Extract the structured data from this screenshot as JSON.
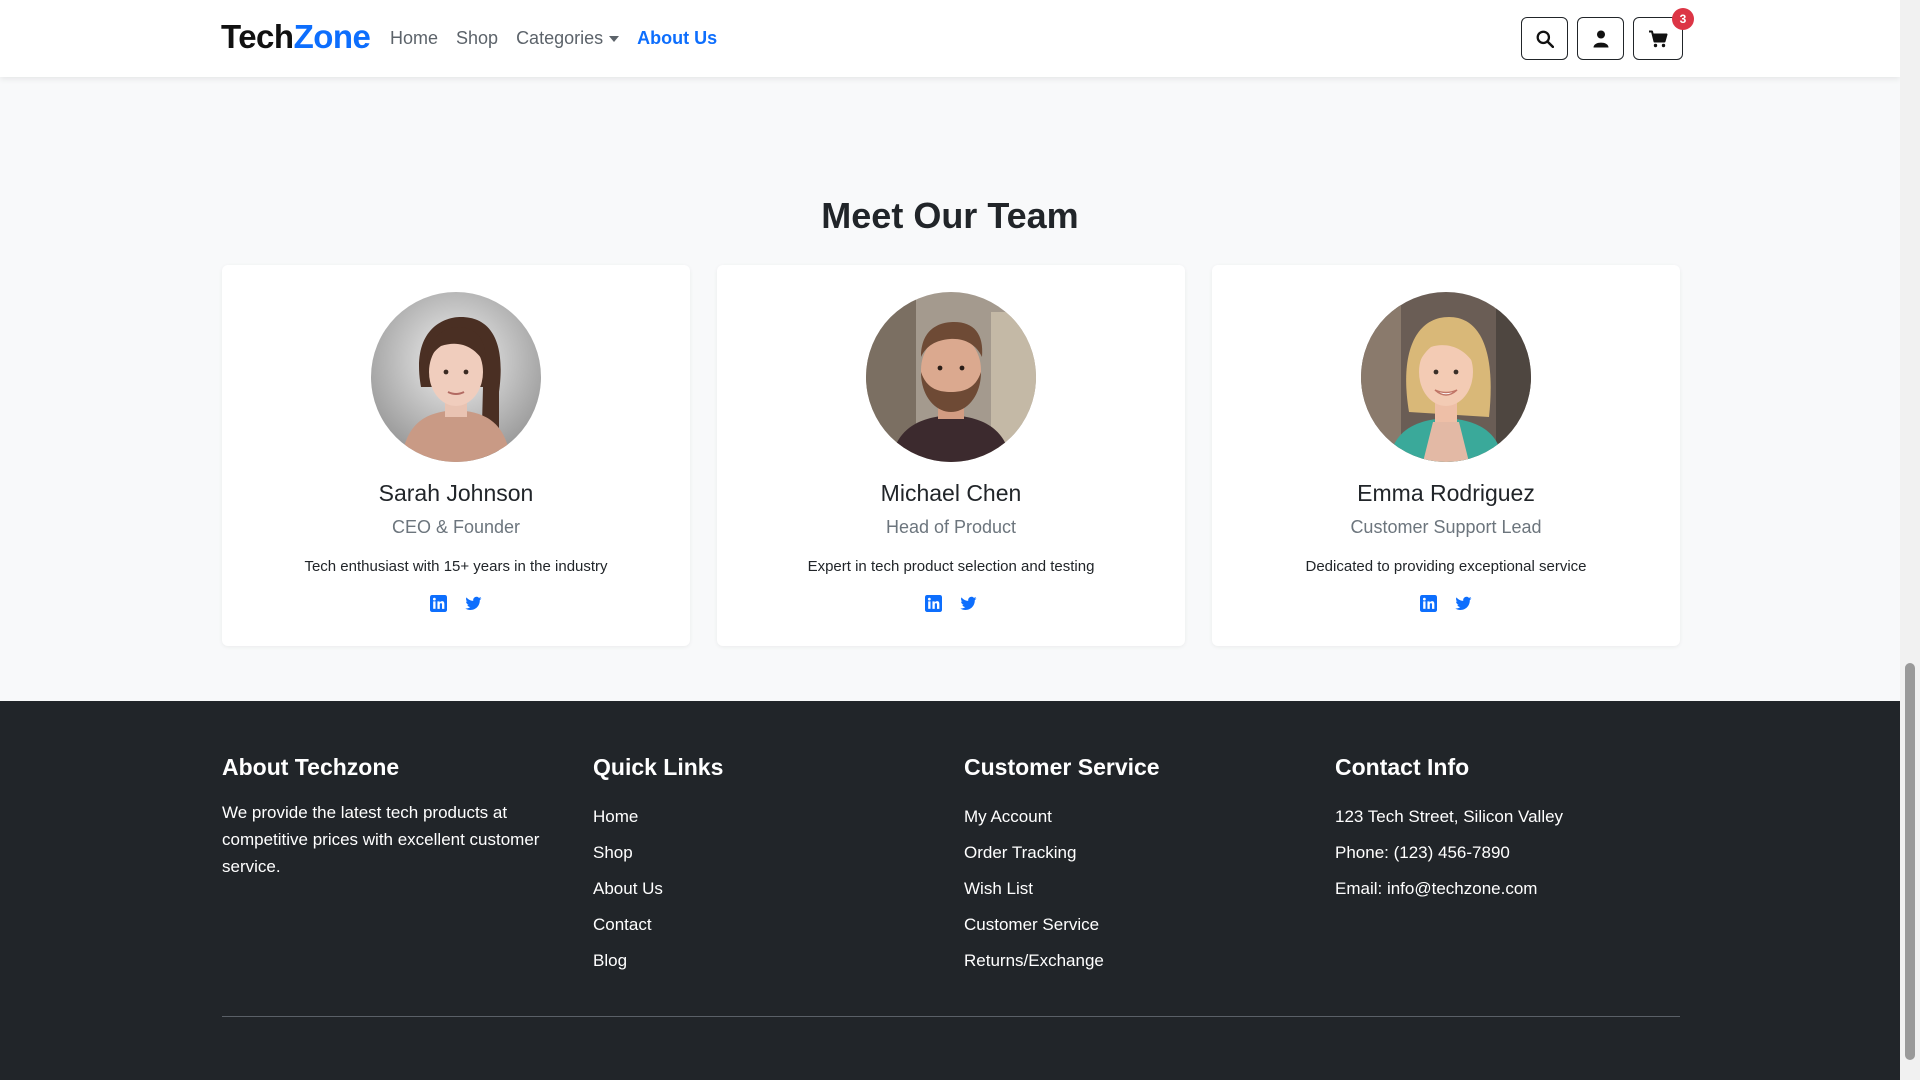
{
  "brand": {
    "part1": "Tech",
    "part2": "Zone"
  },
  "nav": {
    "home": "Home",
    "shop": "Shop",
    "categories": "Categories",
    "about": "About Us",
    "cart_count": "3"
  },
  "team": {
    "title": "Meet Our Team",
    "members": [
      {
        "name": "Sarah Johnson",
        "role": "CEO & Founder",
        "bio": "Tech enthusiast with 15+ years in the industry"
      },
      {
        "name": "Michael Chen",
        "role": "Head of Product",
        "bio": "Expert in tech product selection and testing"
      },
      {
        "name": "Emma Rodriguez",
        "role": "Customer Support Lead",
        "bio": "Dedicated to providing exceptional service"
      }
    ]
  },
  "footer": {
    "about": {
      "title": "About Techzone",
      "text": "We provide the latest tech products at competitive prices with excellent customer service."
    },
    "quick_links": {
      "title": "Quick Links",
      "items": [
        "Home",
        "Shop",
        "About Us",
        "Contact",
        "Blog"
      ]
    },
    "customer_service": {
      "title": "Customer Service",
      "items": [
        "My Account",
        "Order Tracking",
        "Wish List",
        "Customer Service",
        "Returns/Exchange"
      ]
    },
    "contact": {
      "title": "Contact Info",
      "items": [
        "123 Tech Street, Silicon Valley",
        "Phone: (123) 456-7890",
        "Email: info@techzone.com"
      ]
    }
  },
  "colors": {
    "accent": "#0d6efd",
    "footer_bg": "#212529",
    "badge": "#dc3545"
  }
}
